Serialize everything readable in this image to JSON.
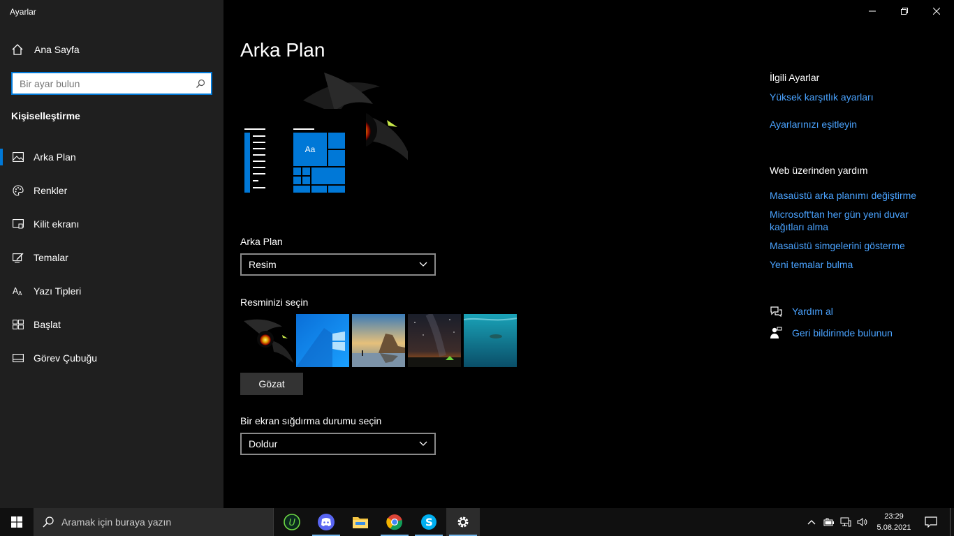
{
  "app": {
    "title": "Ayarlar"
  },
  "sidebar": {
    "home_label": "Ana Sayfa",
    "search_placeholder": "Bir ayar bulun",
    "section_title": "Kişiselleştirme",
    "items": [
      {
        "label": "Arka Plan",
        "icon": "picture-icon",
        "active": true
      },
      {
        "label": "Renkler",
        "icon": "palette-icon"
      },
      {
        "label": "Kilit ekranı",
        "icon": "lock-screen-icon"
      },
      {
        "label": "Temalar",
        "icon": "themes-icon"
      },
      {
        "label": "Yazı Tipleri",
        "icon": "fonts-icon"
      },
      {
        "label": "Başlat",
        "icon": "start-icon"
      },
      {
        "label": "Görev Çubuğu",
        "icon": "taskbar-icon"
      }
    ]
  },
  "main": {
    "title": "Arka Plan",
    "preview_tile_text": "Aa",
    "background_label": "Arka Plan",
    "background_value": "Resim",
    "choose_picture_label": "Resminizi seçin",
    "browse_label": "Gözat",
    "fit_label": "Bir ekran sığdırma durumu seçin",
    "fit_value": "Doldur"
  },
  "related": {
    "heading": "İlgili Ayarlar",
    "links": [
      "Yüksek karşıtlık ayarları",
      "Ayarlarınızı eşitleyin"
    ],
    "web_heading": "Web üzerinden yardım",
    "web_links": [
      "Masaüstü arka planımı değiştirme",
      "Microsoft'tan her gün yeni duvar kağıtları alma",
      "Masaüstü simgelerini gösterme",
      "Yeni temalar bulma"
    ],
    "help_label": "Yardım al",
    "feedback_label": "Geri bildirimde bulunun"
  },
  "taskbar": {
    "search_placeholder": "Aramak için buraya yazın",
    "time": "23:29",
    "date": "5.08.2021"
  },
  "colors": {
    "accent": "#0078d7",
    "link": "#4aa3ff",
    "sidebar_bg": "#1f1f1f"
  }
}
